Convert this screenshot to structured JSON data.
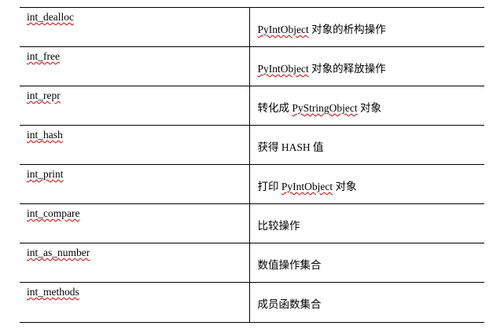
{
  "table": {
    "rows": [
      {
        "name": "int_dealloc",
        "desc_pre": "",
        "desc_object": "PyIntObject",
        "desc_post": " 对象的析构操作"
      },
      {
        "name": "int_free",
        "desc_pre": "",
        "desc_object": "PyIntObject",
        "desc_post": " 对象的释放操作"
      },
      {
        "name": "int_repr",
        "desc_pre": "转化成 ",
        "desc_object": "PyStringObject",
        "desc_post": " 对象"
      },
      {
        "name": "int_hash",
        "desc_pre": "获得 HASH 值",
        "desc_object": "",
        "desc_post": ""
      },
      {
        "name": "int_print",
        "desc_pre": "打印 ",
        "desc_object": "PyIntObject",
        "desc_post": " 对象"
      },
      {
        "name": "int_compare",
        "desc_pre": "比较操作",
        "desc_object": "",
        "desc_post": ""
      },
      {
        "name": "int_as_number",
        "desc_pre": "数值操作集合",
        "desc_object": "",
        "desc_post": ""
      },
      {
        "name": "int_methods",
        "desc_pre": "成员函数集合",
        "desc_object": "",
        "desc_post": ""
      }
    ]
  }
}
